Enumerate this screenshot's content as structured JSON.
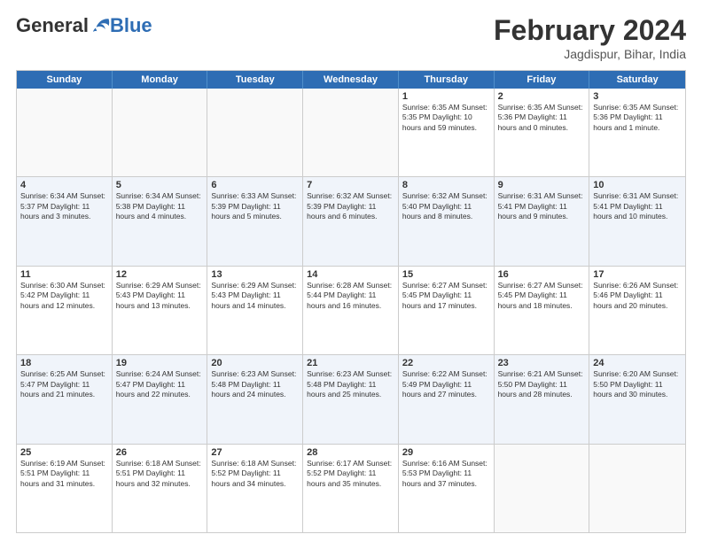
{
  "header": {
    "logo_general": "General",
    "logo_blue": "Blue",
    "title": "February 2024",
    "subtitle": "Jagdispur, Bihar, India"
  },
  "days_of_week": [
    "Sunday",
    "Monday",
    "Tuesday",
    "Wednesday",
    "Thursday",
    "Friday",
    "Saturday"
  ],
  "weeks": [
    [
      {
        "day": "",
        "info": ""
      },
      {
        "day": "",
        "info": ""
      },
      {
        "day": "",
        "info": ""
      },
      {
        "day": "",
        "info": ""
      },
      {
        "day": "1",
        "info": "Sunrise: 6:35 AM\nSunset: 5:35 PM\nDaylight: 10 hours and 59 minutes."
      },
      {
        "day": "2",
        "info": "Sunrise: 6:35 AM\nSunset: 5:36 PM\nDaylight: 11 hours and 0 minutes."
      },
      {
        "day": "3",
        "info": "Sunrise: 6:35 AM\nSunset: 5:36 PM\nDaylight: 11 hours and 1 minute."
      }
    ],
    [
      {
        "day": "4",
        "info": "Sunrise: 6:34 AM\nSunset: 5:37 PM\nDaylight: 11 hours and 3 minutes."
      },
      {
        "day": "5",
        "info": "Sunrise: 6:34 AM\nSunset: 5:38 PM\nDaylight: 11 hours and 4 minutes."
      },
      {
        "day": "6",
        "info": "Sunrise: 6:33 AM\nSunset: 5:39 PM\nDaylight: 11 hours and 5 minutes."
      },
      {
        "day": "7",
        "info": "Sunrise: 6:32 AM\nSunset: 5:39 PM\nDaylight: 11 hours and 6 minutes."
      },
      {
        "day": "8",
        "info": "Sunrise: 6:32 AM\nSunset: 5:40 PM\nDaylight: 11 hours and 8 minutes."
      },
      {
        "day": "9",
        "info": "Sunrise: 6:31 AM\nSunset: 5:41 PM\nDaylight: 11 hours and 9 minutes."
      },
      {
        "day": "10",
        "info": "Sunrise: 6:31 AM\nSunset: 5:41 PM\nDaylight: 11 hours and 10 minutes."
      }
    ],
    [
      {
        "day": "11",
        "info": "Sunrise: 6:30 AM\nSunset: 5:42 PM\nDaylight: 11 hours and 12 minutes."
      },
      {
        "day": "12",
        "info": "Sunrise: 6:29 AM\nSunset: 5:43 PM\nDaylight: 11 hours and 13 minutes."
      },
      {
        "day": "13",
        "info": "Sunrise: 6:29 AM\nSunset: 5:43 PM\nDaylight: 11 hours and 14 minutes."
      },
      {
        "day": "14",
        "info": "Sunrise: 6:28 AM\nSunset: 5:44 PM\nDaylight: 11 hours and 16 minutes."
      },
      {
        "day": "15",
        "info": "Sunrise: 6:27 AM\nSunset: 5:45 PM\nDaylight: 11 hours and 17 minutes."
      },
      {
        "day": "16",
        "info": "Sunrise: 6:27 AM\nSunset: 5:45 PM\nDaylight: 11 hours and 18 minutes."
      },
      {
        "day": "17",
        "info": "Sunrise: 6:26 AM\nSunset: 5:46 PM\nDaylight: 11 hours and 20 minutes."
      }
    ],
    [
      {
        "day": "18",
        "info": "Sunrise: 6:25 AM\nSunset: 5:47 PM\nDaylight: 11 hours and 21 minutes."
      },
      {
        "day": "19",
        "info": "Sunrise: 6:24 AM\nSunset: 5:47 PM\nDaylight: 11 hours and 22 minutes."
      },
      {
        "day": "20",
        "info": "Sunrise: 6:23 AM\nSunset: 5:48 PM\nDaylight: 11 hours and 24 minutes."
      },
      {
        "day": "21",
        "info": "Sunrise: 6:23 AM\nSunset: 5:48 PM\nDaylight: 11 hours and 25 minutes."
      },
      {
        "day": "22",
        "info": "Sunrise: 6:22 AM\nSunset: 5:49 PM\nDaylight: 11 hours and 27 minutes."
      },
      {
        "day": "23",
        "info": "Sunrise: 6:21 AM\nSunset: 5:50 PM\nDaylight: 11 hours and 28 minutes."
      },
      {
        "day": "24",
        "info": "Sunrise: 6:20 AM\nSunset: 5:50 PM\nDaylight: 11 hours and 30 minutes."
      }
    ],
    [
      {
        "day": "25",
        "info": "Sunrise: 6:19 AM\nSunset: 5:51 PM\nDaylight: 11 hours and 31 minutes."
      },
      {
        "day": "26",
        "info": "Sunrise: 6:18 AM\nSunset: 5:51 PM\nDaylight: 11 hours and 32 minutes."
      },
      {
        "day": "27",
        "info": "Sunrise: 6:18 AM\nSunset: 5:52 PM\nDaylight: 11 hours and 34 minutes."
      },
      {
        "day": "28",
        "info": "Sunrise: 6:17 AM\nSunset: 5:52 PM\nDaylight: 11 hours and 35 minutes."
      },
      {
        "day": "29",
        "info": "Sunrise: 6:16 AM\nSunset: 5:53 PM\nDaylight: 11 hours and 37 minutes."
      },
      {
        "day": "",
        "info": ""
      },
      {
        "day": "",
        "info": ""
      }
    ]
  ]
}
